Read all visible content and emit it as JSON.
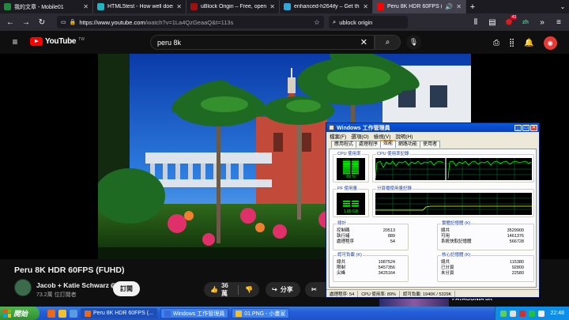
{
  "browser": {
    "tabs": [
      {
        "title": "我的文章 - Mobile01",
        "color": "#1f8a3b"
      },
      {
        "title": "HTML5test - How well does yo",
        "color": "#1fb5c6"
      },
      {
        "title": "uBlock Origin – Free, open-sou",
        "color": "#a01010"
      },
      {
        "title": "enhanced-h264ify – Get this Ext",
        "color": "#2ea8d8"
      },
      {
        "title": "Peru 8K HDR 60FPS (FUHD)",
        "color": "#ff0000",
        "active": true
      }
    ],
    "url_host": "https://www.youtube.com",
    "url_path": "/watch?v=1La4QzGeaaQ&t=113s",
    "search_text": "ublock origin",
    "ext_badge": "43",
    "ext_label": "zh"
  },
  "youtube": {
    "logo_text": "YouTube",
    "logo_tm": "TW",
    "search_value": "peru 8k"
  },
  "video": {
    "title": "Peru 8K HDR 60FPS (FUHD)",
    "channel": "Jacob + Katie Schwarz",
    "subscribers": "73.2萬 位訂閱者",
    "subscribe_label": "訂閱",
    "likes": "36萬",
    "share_label": "分享",
    "sidebar_title": "PATAGONIA 8K"
  },
  "taskmgr": {
    "title": "Windows 工作管理員",
    "menu": [
      "檔案(F)",
      "選項(O)",
      "檢視(V)",
      "說明(H)"
    ],
    "tabs": [
      "應用程式",
      "處理程序",
      "效能",
      "網路功能",
      "使用者"
    ],
    "active_tab": "效能",
    "cpu_usage_label": "CPU 使用率",
    "cpu_usage_value": "89 %",
    "cpu_usage_pct": 89,
    "cpu_history_label": "CPU 使用率記錄",
    "pf_label": "PF 使用量",
    "pf_value": "1.89 GB",
    "pf_history_label": "分頁檔使用量記錄",
    "totals_label": "總計",
    "totals": [
      {
        "label": "控制碼",
        "value": "20513"
      },
      {
        "label": "執行緒",
        "value": "889"
      },
      {
        "label": "處理程序",
        "value": "54"
      }
    ],
    "physical_label": "實體記憶體 (K)",
    "physical": [
      {
        "label": "總共",
        "value": "3529900"
      },
      {
        "label": "可用",
        "value": "1461376"
      },
      {
        "label": "系統快取記憶體",
        "value": "566728"
      }
    ],
    "commit_label": "認可負載 (K)",
    "commit": [
      {
        "label": "總共",
        "value": "1987524"
      },
      {
        "label": "限制",
        "value": "5457356"
      },
      {
        "label": "尖峰",
        "value": "3425164"
      }
    ],
    "kernel_label": "核心記憶體 (K)",
    "kernel": [
      {
        "label": "總共",
        "value": "115380"
      },
      {
        "label": "已分頁",
        "value": "92800"
      },
      {
        "label": "未分頁",
        "value": "22580"
      }
    ],
    "status_processes": "處理程序: 54",
    "status_cpu": "CPU 使用率: 89%",
    "status_commit": "認可負載: 1940K / 5329K"
  },
  "taskbar": {
    "start_label": "開始",
    "tasks": [
      {
        "label": "Peru 8K HDR 60FPS (...",
        "color": "#e86a1a",
        "pressed": true
      },
      {
        "label": "Windows 工作管理員",
        "color": "#3a6ad8"
      },
      {
        "label": "01.PNG - 小畫家",
        "color": "#f0c030"
      }
    ],
    "clock": "22:48"
  }
}
